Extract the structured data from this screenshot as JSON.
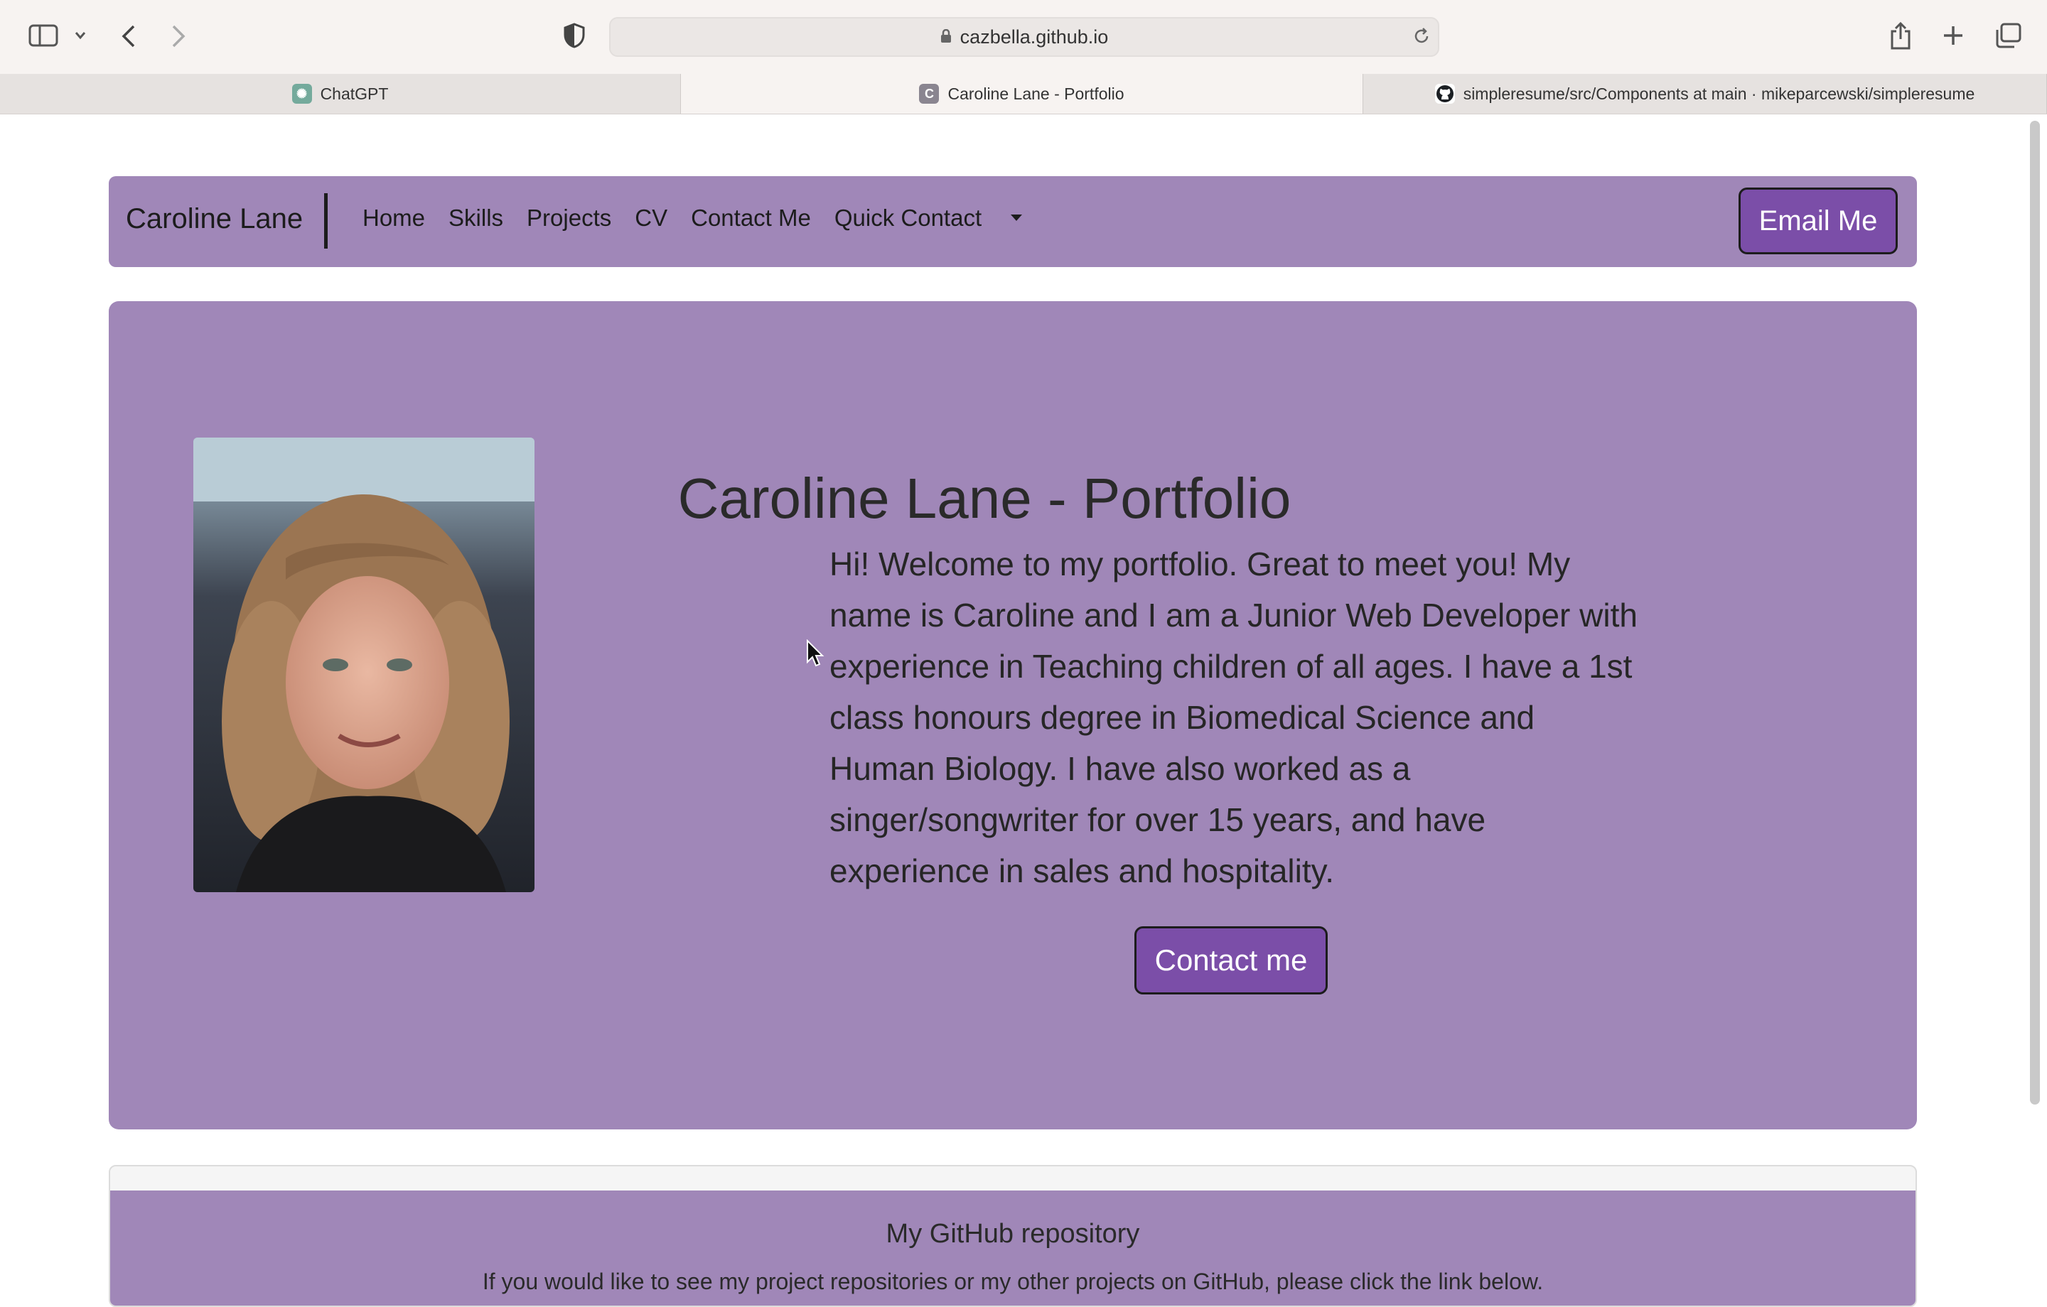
{
  "browser": {
    "url": "cazbella.github.io",
    "tabs": [
      {
        "label": "ChatGPT",
        "icon": "chatgpt-favicon"
      },
      {
        "label": "Caroline Lane - Portfolio",
        "icon": "c-favicon"
      },
      {
        "label": "simpleresume/src/Components at main · mikeparcewski/simpleresume",
        "icon": "github-favicon"
      }
    ]
  },
  "navbar": {
    "brand": "Caroline Lane",
    "links": [
      "Home",
      "Skills",
      "Projects",
      "CV",
      "Contact Me"
    ],
    "dropdown": "Quick Contact",
    "email_button": "Email Me"
  },
  "hero": {
    "title": "Caroline Lane - Portfolio",
    "text": "Hi! Welcome to my portfolio. Great to meet you! My name is Caroline and I am a Junior Web Developer with experience in Teaching children of all ages. I have a 1st class honours degree in Biomedical Science and Human Biology. I have also worked as a singer/songwriter for over 15 years, and have experience in sales and hospitality.",
    "button": "Contact me"
  },
  "github_card": {
    "title": "My GitHub repository",
    "text": "If you would like to see my project repositories or my other projects on GitHub, please click the link below."
  },
  "colors": {
    "accent": "#a087b8",
    "button": "#7b4ea8"
  }
}
